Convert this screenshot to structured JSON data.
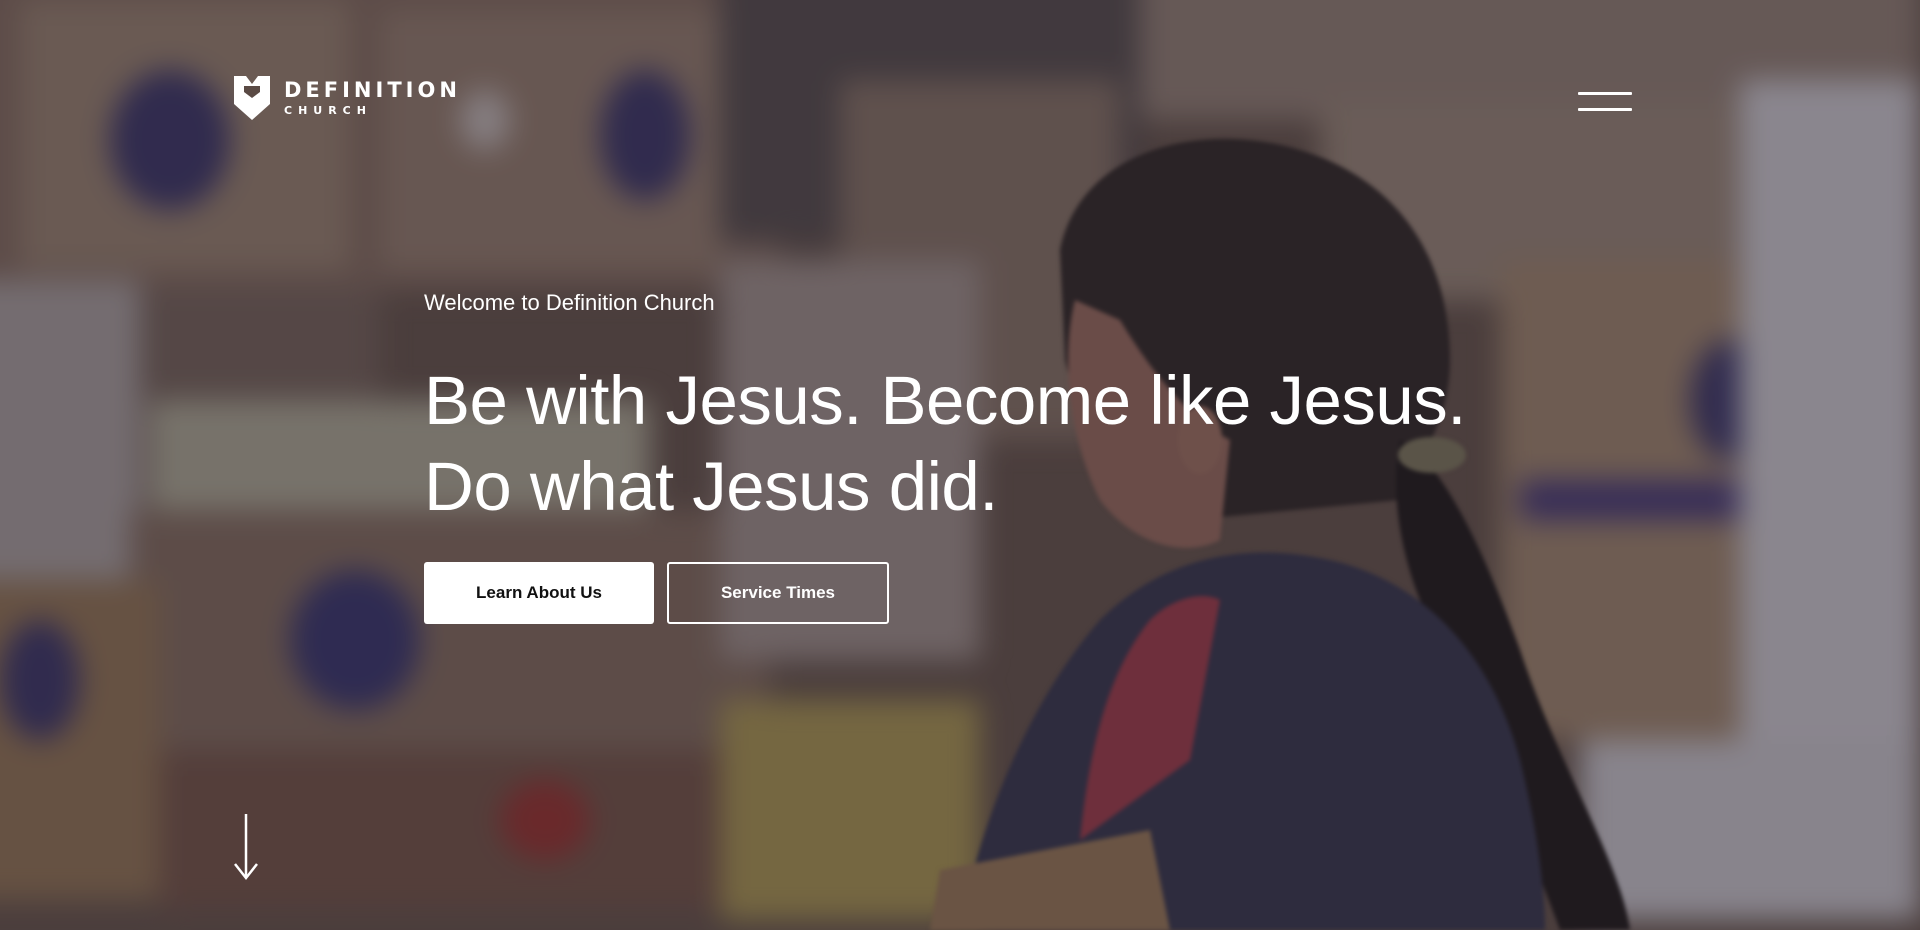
{
  "brand": {
    "name": "DEFINITION",
    "subname": "CHURCH",
    "logo_icon": "definition-shield-logo"
  },
  "header": {
    "menu_icon": "hamburger-menu-icon"
  },
  "hero": {
    "eyebrow": "Welcome to Definition Church",
    "headline_line1": "Be with Jesus. Become like Jesus.",
    "headline_line2": "Do what Jesus did.",
    "primary_button": "Learn About Us",
    "secondary_button": "Service Times",
    "scroll_icon": "arrow-down-icon"
  },
  "colors": {
    "text": "#ffffff",
    "primary_button_bg": "#ffffff",
    "primary_button_text": "#111111"
  }
}
